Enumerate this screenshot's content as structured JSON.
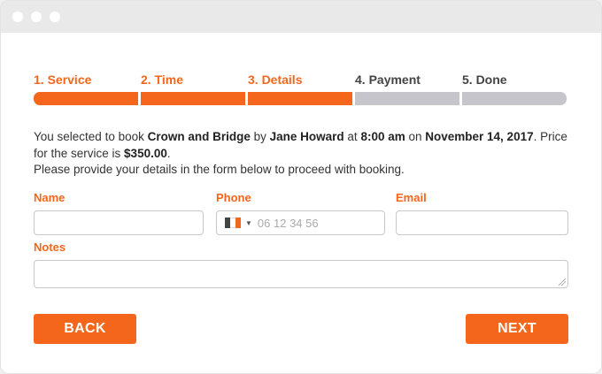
{
  "steps": [
    {
      "label": "1. Service",
      "active": true
    },
    {
      "label": "2. Time",
      "active": true
    },
    {
      "label": "3. Details",
      "active": true
    },
    {
      "label": "4. Payment",
      "active": false
    },
    {
      "label": "5. Done",
      "active": false
    }
  ],
  "info": {
    "p1": "You selected to book ",
    "service": "Crown and Bridge",
    "p2": " by ",
    "staff": "Jane Howard",
    "p3": " at ",
    "time": "8:00 am",
    "p4": " on ",
    "date": "November 14, 2017",
    "p5": ". Price for the service is ",
    "price": "$350.00",
    "p6": ".",
    "line2": "Please provide your details in the form below to proceed with booking."
  },
  "form": {
    "name_label": "Name",
    "name_value": "",
    "phone_label": "Phone",
    "phone_placeholder": "06 12 34 56",
    "email_label": "Email",
    "email_value": "",
    "notes_label": "Notes",
    "notes_value": ""
  },
  "buttons": {
    "back": "BACK",
    "next": "NEXT"
  },
  "colors": {
    "accent": "#f4661b",
    "inactive_step": "#c5c5cb",
    "flag": [
      "#444444",
      "#ffffff",
      "#f4661b"
    ]
  }
}
